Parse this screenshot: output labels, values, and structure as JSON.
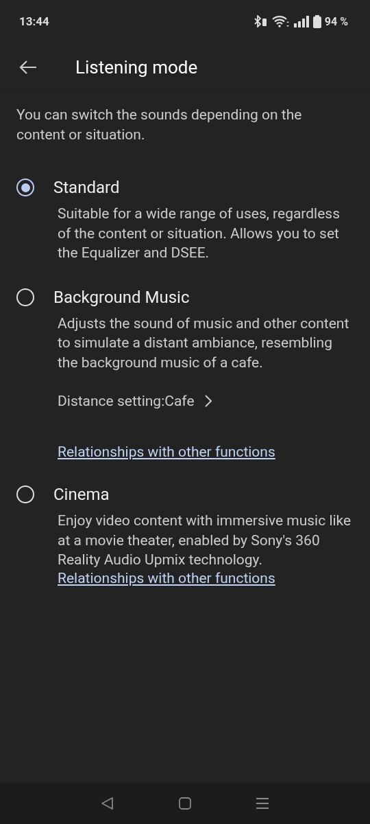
{
  "status_bar": {
    "time": "13:44",
    "battery": "94 %"
  },
  "header": {
    "title": "Listening mode"
  },
  "intro": "You can switch the sounds depending on the content or situation.",
  "options": [
    {
      "title": "Standard",
      "selected": true,
      "description": "Suitable for a wide range of uses, regardless of the content or situation. Allows you to set the Equalizer and DSEE."
    },
    {
      "title": "Background Music",
      "selected": false,
      "description": "Adjusts the sound of music and other content to simulate a distant ambiance, resembling the background music of a cafe.",
      "setting": "Distance setting:Cafe",
      "link": "Relationships with other functions"
    },
    {
      "title": "Cinema",
      "selected": false,
      "description": "Enjoy video content with immersive music like at a movie theater, enabled by Sony's 360 Reality Audio Upmix technology.",
      "link": "Relationships with other functions"
    }
  ]
}
